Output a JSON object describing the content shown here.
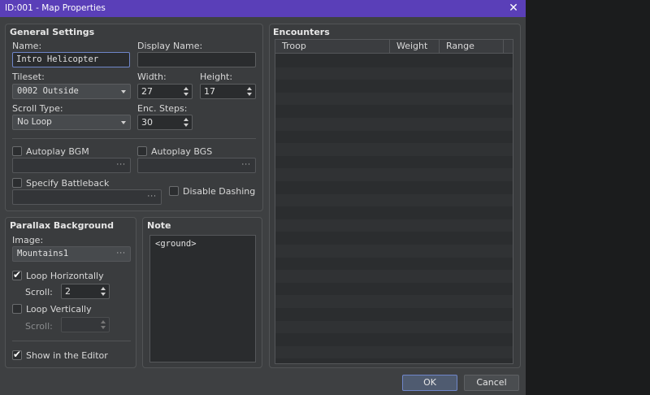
{
  "window": {
    "title": "ID:001 - Map Properties",
    "close_glyph": "✕"
  },
  "general": {
    "title": "General Settings",
    "name_label": "Name:",
    "name_value": "Intro Helicopter",
    "display_name_label": "Display Name:",
    "display_name_value": "",
    "tileset_label": "Tileset:",
    "tileset_value": "0002 Outside",
    "width_label": "Width:",
    "width_value": "27",
    "height_label": "Height:",
    "height_value": "17",
    "scroll_type_label": "Scroll Type:",
    "scroll_type_value": "No Loop",
    "enc_steps_label": "Enc. Steps:",
    "enc_steps_value": "30",
    "autoplay_bgm_label": "Autoplay BGM",
    "autoplay_bgm_checked": false,
    "autoplay_bgs_label": "Autoplay BGS",
    "autoplay_bgs_checked": false,
    "specify_battleback_label": "Specify Battleback",
    "specify_battleback_checked": false,
    "disable_dashing_label": "Disable Dashing",
    "disable_dashing_checked": false,
    "ellipsis": "···"
  },
  "parallax": {
    "title": "Parallax Background",
    "image_label": "Image:",
    "image_value": "Mountains1",
    "loop_h_label": "Loop Horizontally",
    "loop_h_checked": true,
    "scroll_h_label": "Scroll:",
    "scroll_h_value": "2",
    "loop_v_label": "Loop Vertically",
    "loop_v_checked": false,
    "scroll_v_label": "Scroll:",
    "scroll_v_value": "",
    "show_editor_label": "Show in the Editor",
    "show_editor_checked": true,
    "check_glyph": "✔"
  },
  "note": {
    "title": "Note",
    "text": "<ground>"
  },
  "encounters": {
    "title": "Encounters",
    "columns": [
      "Troop",
      "Weight",
      "Range"
    ],
    "rows": []
  },
  "buttons": {
    "ok": "OK",
    "cancel": "Cancel"
  },
  "colors": {
    "titlebar": "#5a3fb8",
    "accent_focus": "#6f86c9",
    "panel": "#3e4042"
  }
}
